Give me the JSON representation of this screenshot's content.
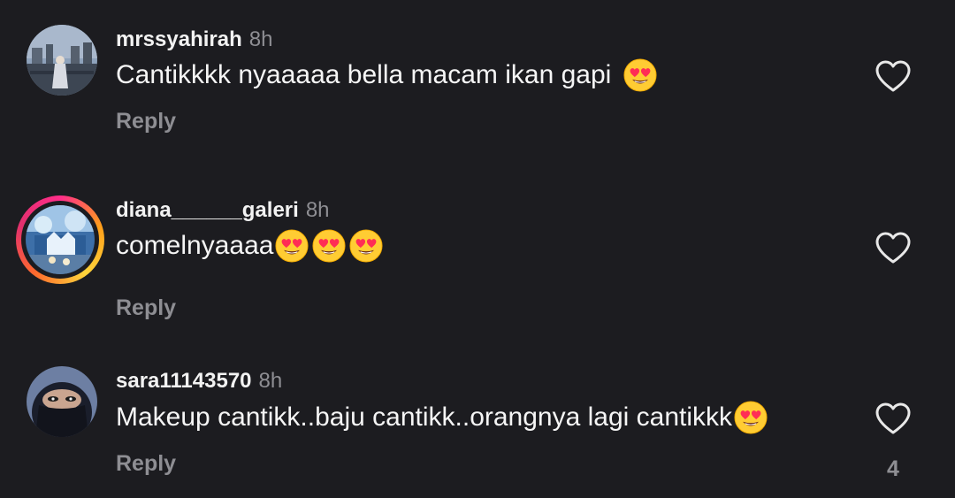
{
  "comments": [
    {
      "username": "mrssyahirah",
      "time": "8h",
      "text": "Cantikkkk nyaaaaa bella macam ikan gapi",
      "emoji_count": 1,
      "reply_label": "Reply",
      "has_story_ring": false
    },
    {
      "username": "diana______galeri",
      "time": "8h",
      "text": "comelnyaaaa",
      "emoji_count": 3,
      "reply_label": "Reply",
      "has_story_ring": true
    },
    {
      "username": "sara11143570",
      "time": "8h",
      "text": "Makeup cantikk..baju cantikk..orangnya lagi cantikkk",
      "emoji_count": 1,
      "reply_label": "Reply",
      "has_story_ring": false,
      "like_count": "4"
    }
  ],
  "icons": {
    "emoji": "heart-eyes-emoji-icon",
    "like": "heart-outline-icon"
  },
  "colors": {
    "background": "#1c1c20",
    "text": "#f5f5f5",
    "muted": "#8e8e93",
    "ring_start": "#ff2d8a",
    "ring_end": "#ffd43b"
  }
}
